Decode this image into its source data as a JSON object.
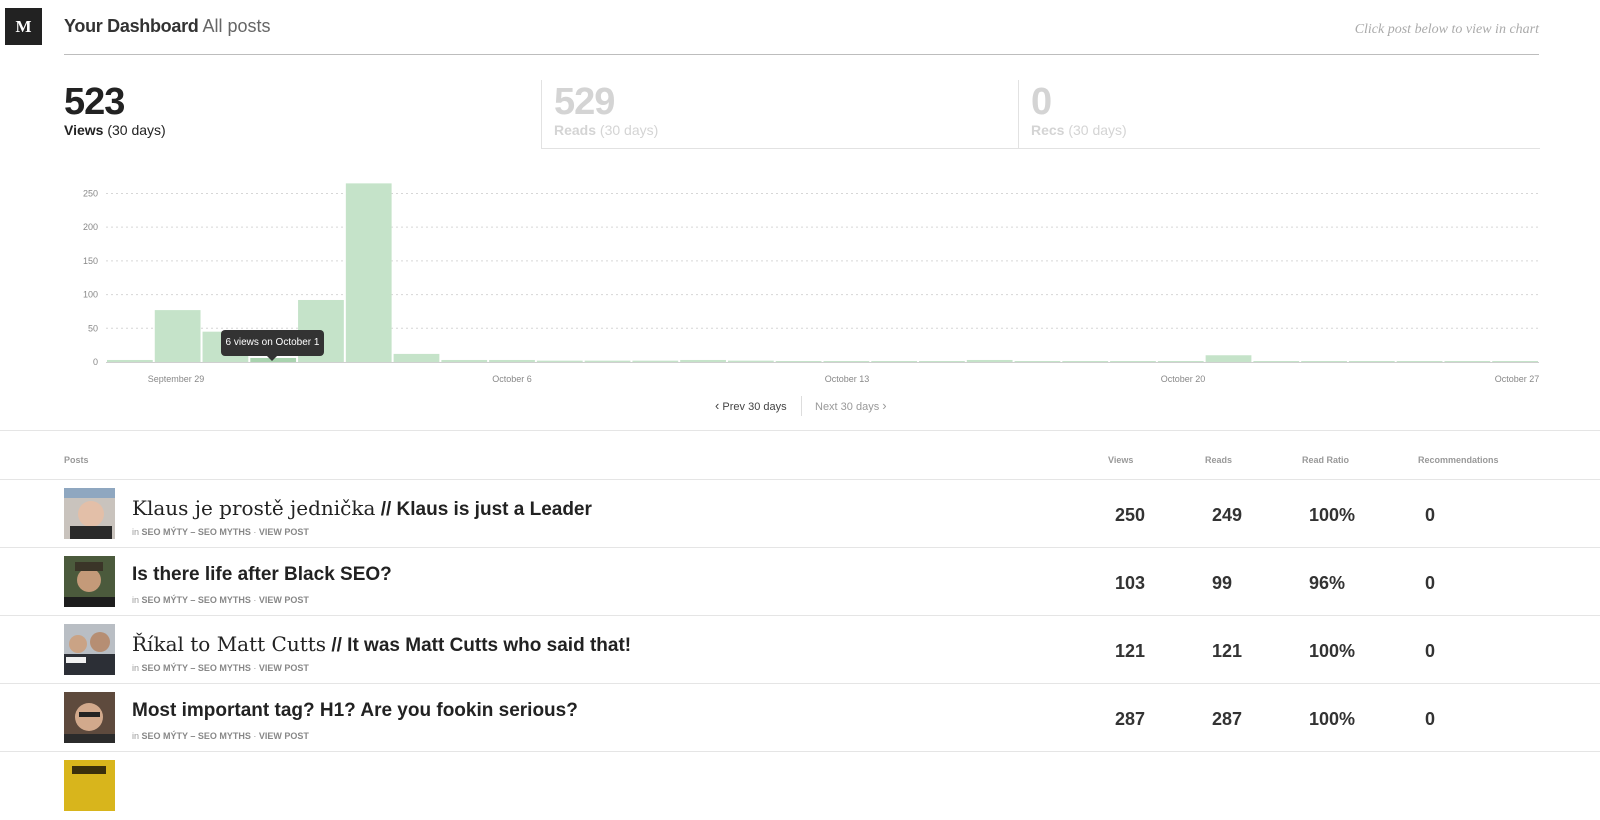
{
  "header": {
    "logo": "M",
    "title_strong": "Your Dashboard",
    "title_light": "All posts",
    "hint": "Click post below to view in chart"
  },
  "stats": [
    {
      "value": "523",
      "label": "Views",
      "period": "(30 days)"
    },
    {
      "value": "529",
      "label": "Reads",
      "period": "(30 days)"
    },
    {
      "value": "0",
      "label": "Recs",
      "period": "(30 days)"
    }
  ],
  "chart_data": {
    "type": "bar",
    "y_ticks": [
      0,
      50,
      100,
      150,
      200,
      250
    ],
    "ylim": [
      0,
      270
    ],
    "x_tick_labels": [
      "September 29",
      "October 6",
      "October 13",
      "October 20",
      "October 27"
    ],
    "values": [
      3,
      77,
      45,
      6,
      92,
      265,
      12,
      3,
      3,
      2,
      2,
      2,
      3,
      2,
      1,
      1,
      1,
      1,
      3,
      1,
      1,
      1,
      0,
      10,
      1,
      1,
      1,
      1,
      1,
      1
    ],
    "tooltip": "6 views on October 1",
    "colors": {
      "bar": "#c5e3c9",
      "bar_active": "#a8d3ae",
      "grid": "#d6d6d6"
    }
  },
  "pager": {
    "prev": "Prev 30 days",
    "next": "Next 30 days"
  },
  "table": {
    "columns": {
      "posts": "Posts",
      "views": "Views",
      "reads": "Reads",
      "ratio": "Read Ratio",
      "recs": "Recommendations"
    },
    "rows": [
      {
        "title_lead": "Klaus je prostě jednička",
        "title_rest": "// Klaus is just a Leader",
        "publication": "SEO MÝTY – SEO MYTHS",
        "views": "250",
        "reads": "249",
        "ratio": "100%",
        "recs": "0"
      },
      {
        "title_lead": "",
        "title_rest": "Is there life after Black SEO?",
        "publication": "SEO MÝTY – SEO MYTHS",
        "views": "103",
        "reads": "99",
        "ratio": "96%",
        "recs": "0"
      },
      {
        "title_lead": "Říkal to Matt Cutts",
        "title_rest": "// It was Matt Cutts who said that!",
        "publication": "SEO MÝTY – SEO MYTHS",
        "views": "121",
        "reads": "121",
        "ratio": "100%",
        "recs": "0"
      },
      {
        "title_lead": "",
        "title_rest": "Most important tag? H1? Are you fookin serious?",
        "publication": "SEO MÝTY – SEO MYTHS",
        "views": "287",
        "reads": "287",
        "ratio": "100%",
        "recs": "0"
      }
    ],
    "meta_in": "in",
    "meta_view": "VIEW POST",
    "meta_sep": "·"
  }
}
